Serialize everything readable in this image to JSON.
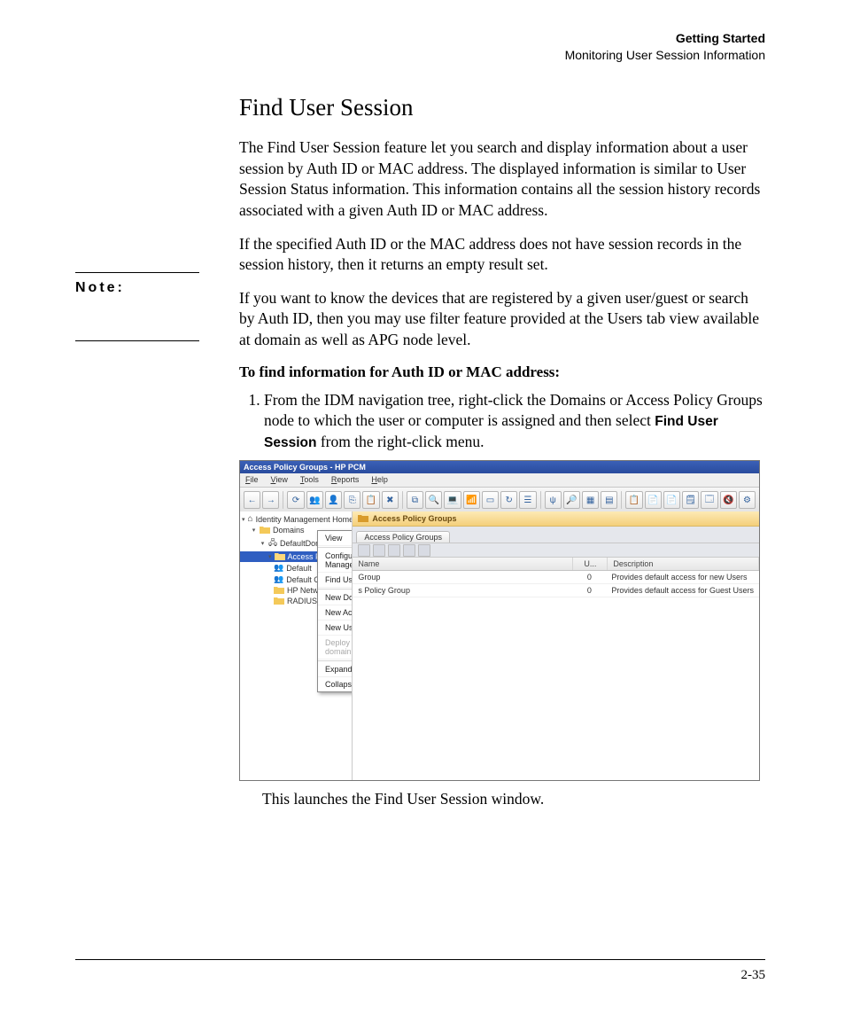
{
  "header": {
    "line1": "Getting Started",
    "line2": "Monitoring User Session Information"
  },
  "heading": "Find User Session",
  "para1": "The Find User Session feature let you search and display information about a user session by Auth ID or MAC address. The displayed information is similar to User Session Status information. This information contains all the session history records associated with a given Auth ID or MAC address.",
  "para2": "If the specified Auth ID or the MAC address does not have session records in the session history, then it returns an empty result set.",
  "note_label": "Note:",
  "note_text": "If you want to know the devices that are registered by a given user/guest or search by Auth ID, then you may use filter feature provided at the Users tab view available at domain as well as APG node level.",
  "subheading": "To find information for Auth ID or MAC address:",
  "step1_pre": "From the IDM navigation tree, right-click the Domains or Access Policy Groups node to which the user or computer is assigned and then select ",
  "step1_bold": "Find User Session",
  "step1_post": " from the right-click menu.",
  "after_figure": "This launches the Find User Session window.",
  "page_number": "2-35",
  "app": {
    "title": "Access Policy Groups - HP PCM",
    "menus": [
      "File",
      "View",
      "Tools",
      "Reports",
      "Help"
    ],
    "toolbar_icons": [
      "back-icon",
      "forward-icon",
      "refresh-icon",
      "users-icon",
      "user-icon",
      "copy-icon",
      "paste-icon",
      "delete-icon",
      "switch-icon",
      "find-icon",
      "devices-icon",
      "wifi-icon",
      "port-icon",
      "sync-icon",
      "stack-icon",
      "usb-icon",
      "search-icon",
      "grid-icon",
      "table-icon",
      "clipboard-icon",
      "doc-icon",
      "doc2-icon",
      "note-icon",
      "window-icon",
      "mute-icon",
      "gear-icon"
    ],
    "toolbar_glyphs": [
      "←",
      "→",
      "⟳",
      "👥",
      "👤",
      "⎘",
      "📋",
      "✖",
      "⧉",
      "🔍",
      "💻",
      "📶",
      "▭",
      "↻",
      "☰",
      "ψ",
      "🔎",
      "▦",
      "▤",
      "📋",
      "📄",
      "📄",
      "🗒",
      "🗔",
      "🔇",
      "⚙"
    ],
    "tree": {
      "root": "Identity Management Home",
      "domains": "Domains",
      "default_domain": "DefaultDomain",
      "selected": "Access Policy Groups",
      "children": [
        "Default",
        "Default C",
        "HP Network",
        "RADIUS De"
      ]
    },
    "crumb": "Access Policy Groups",
    "tab": "Access Policy Groups",
    "table": {
      "headers": [
        "Name",
        "U...",
        "Description"
      ],
      "rows": [
        {
          "name": "Group",
          "u": "0",
          "desc": "Provides default access for new Users"
        },
        {
          "name": "s Policy Group",
          "u": "0",
          "desc": "Provides default access for Guest Users"
        }
      ]
    },
    "context_menu": [
      {
        "label": "View",
        "type": "item"
      },
      {
        "type": "sep"
      },
      {
        "label": "Configure Identity Management...",
        "type": "item"
      },
      {
        "label": "Find User Session...",
        "type": "item"
      },
      {
        "type": "sep"
      },
      {
        "label": "New Domain...",
        "type": "item"
      },
      {
        "label": "New Access Policy Group...",
        "type": "item"
      },
      {
        "label": "New User...",
        "type": "item"
      },
      {
        "label": "Deploy current policy to this domain",
        "type": "disabled"
      },
      {
        "type": "sep"
      },
      {
        "label": "Expand",
        "type": "item"
      },
      {
        "label": "Collapse",
        "type": "item"
      }
    ]
  }
}
